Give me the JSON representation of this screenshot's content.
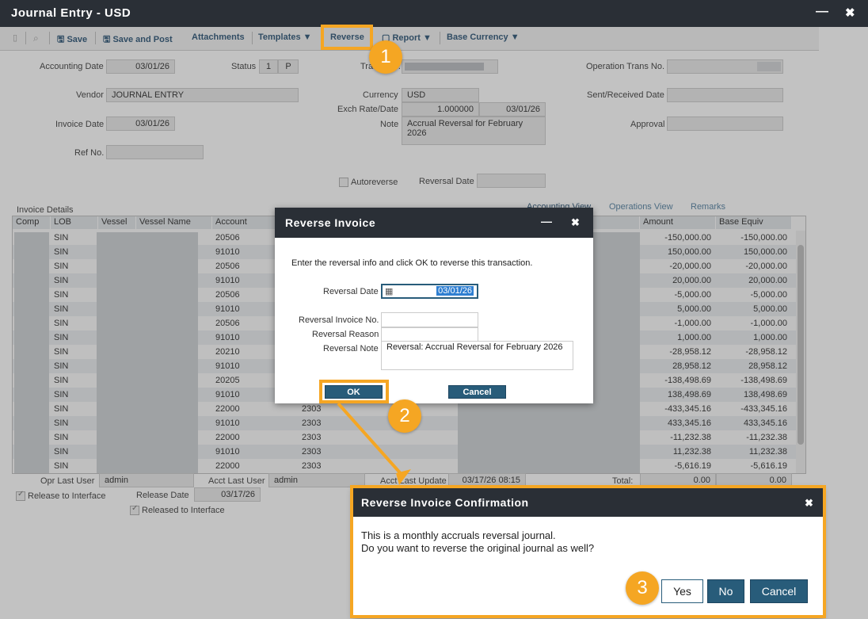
{
  "window": {
    "title": "Journal Entry - USD"
  },
  "toolbar": {
    "save": "Save",
    "save_post": "Save and Post",
    "attachments": "Attachments",
    "templates": "Templates",
    "reverse": "Reverse",
    "report": "Report",
    "base_currency": "Base Currency"
  },
  "header": {
    "accounting_date_label": "Accounting Date",
    "accounting_date": "03/01/26",
    "status_label": "Status",
    "status_num": "1",
    "status_code": "P",
    "trans_label": "Trans. No.",
    "op_trans_label": "Operation Trans No.",
    "vendor_label": "Vendor",
    "vendor": "JOURNAL ENTRY",
    "currency_label": "Currency",
    "currency": "USD",
    "exch_label": "Exch Rate/Date",
    "exch_rate": "1.000000",
    "exch_date": "03/01/26",
    "sent_label": "Sent/Received Date",
    "invoice_date_label": "Invoice Date",
    "invoice_date": "03/01/26",
    "note_label": "Note",
    "note": "Accrual Reversal for February 2026",
    "approval_label": "Approval",
    "ref_label": "Ref No.",
    "autoreverse_label": "Autoreverse",
    "reversal_date_label": "Reversal Date"
  },
  "grid": {
    "section_label": "Invoice Details",
    "tabs": [
      "Accounting View",
      "Operations View",
      "Remarks"
    ],
    "columns": [
      "Comp",
      "LOB",
      "Vessel",
      "Vessel Name",
      "Account",
      "Amount",
      "Base Equiv"
    ],
    "rows": [
      {
        "lob": "SIN",
        "account": "20506",
        "sub": "",
        "amount": "-150,000.00",
        "base": "-150,000.00"
      },
      {
        "lob": "SIN",
        "account": "91010",
        "sub": "",
        "amount": "150,000.00",
        "base": "150,000.00"
      },
      {
        "lob": "SIN",
        "account": "20506",
        "sub": "",
        "amount": "-20,000.00",
        "base": "-20,000.00"
      },
      {
        "lob": "SIN",
        "account": "91010",
        "sub": "",
        "amount": "20,000.00",
        "base": "20,000.00"
      },
      {
        "lob": "SIN",
        "account": "20506",
        "sub": "",
        "amount": "-5,000.00",
        "base": "-5,000.00"
      },
      {
        "lob": "SIN",
        "account": "91010",
        "sub": "",
        "amount": "5,000.00",
        "base": "5,000.00"
      },
      {
        "lob": "SIN",
        "account": "20506",
        "sub": "",
        "amount": "-1,000.00",
        "base": "-1,000.00"
      },
      {
        "lob": "SIN",
        "account": "91010",
        "sub": "",
        "amount": "1,000.00",
        "base": "1,000.00"
      },
      {
        "lob": "SIN",
        "account": "20210",
        "sub": "",
        "amount": "-28,958.12",
        "base": "-28,958.12"
      },
      {
        "lob": "SIN",
        "account": "91010",
        "sub": "",
        "amount": "28,958.12",
        "base": "28,958.12"
      },
      {
        "lob": "SIN",
        "account": "20205",
        "sub": "",
        "amount": "-138,498.69",
        "base": "-138,498.69"
      },
      {
        "lob": "SIN",
        "account": "91010",
        "sub": "",
        "amount": "138,498.69",
        "base": "138,498.69"
      },
      {
        "lob": "SIN",
        "account": "22000",
        "sub": "2303",
        "amount": "-433,345.16",
        "base": "-433,345.16"
      },
      {
        "lob": "SIN",
        "account": "91010",
        "sub": "2303",
        "amount": "433,345.16",
        "base": "433,345.16"
      },
      {
        "lob": "SIN",
        "account": "22000",
        "sub": "2303",
        "amount": "-11,232.38",
        "base": "-11,232.38"
      },
      {
        "lob": "SIN",
        "account": "91010",
        "sub": "2303",
        "amount": "11,232.38",
        "base": "11,232.38"
      },
      {
        "lob": "SIN",
        "account": "22000",
        "sub": "2303",
        "amount": "-5,616.19",
        "base": "-5,616.19"
      }
    ]
  },
  "footer": {
    "opr_last_user_label": "Opr Last User",
    "opr_last_user": "admin",
    "acct_last_user_label": "Acct Last User",
    "acct_last_user": "admin",
    "acct_last_update_label": "Acct Last Update",
    "acct_last_update": "03/17/26 08:15",
    "total_label": "Total:",
    "total_amount": "0.00",
    "total_base": "0.00",
    "release_label": "Release to Interface",
    "release_date_label": "Release Date",
    "release_date": "03/17/26",
    "released_label": "Released to Interface"
  },
  "reverse_dialog": {
    "title": "Reverse Invoice",
    "instruction": "Enter the reversal info and click OK to reverse this transaction.",
    "date_label": "Reversal Date",
    "date": "03/01/26",
    "invoice_no_label": "Reversal Invoice No.",
    "reason_label": "Reversal Reason",
    "note_label": "Reversal Note",
    "note": "Reversal: Accrual Reversal for February 2026",
    "ok": "OK",
    "cancel": "Cancel"
  },
  "confirm_dialog": {
    "title": "Reverse Invoice Confirmation",
    "line1": "This is a monthly accruals reversal journal.",
    "line2": "Do you want to reverse the original journal as well?",
    "yes": "Yes",
    "no": "No",
    "cancel": "Cancel"
  },
  "markers": {
    "m1": "1",
    "m2": "2",
    "m3": "3"
  },
  "colors": {
    "accent": "#f5a623",
    "titlebar": "#2a2f36",
    "button": "#285c7a"
  }
}
